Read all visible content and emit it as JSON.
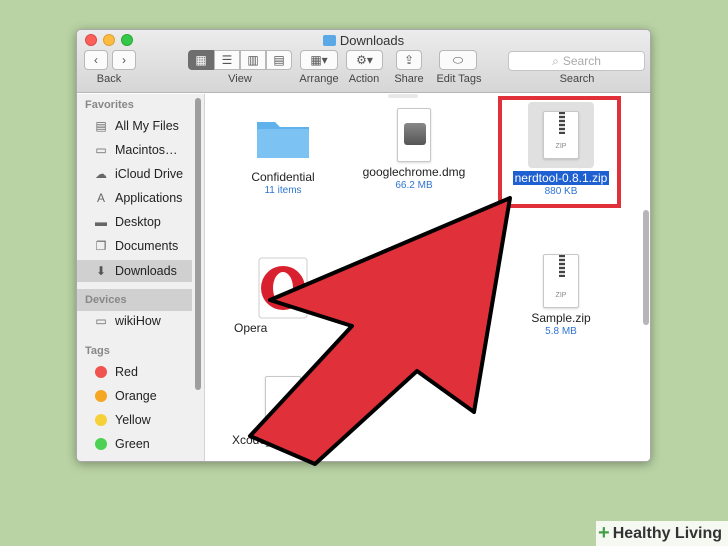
{
  "window": {
    "title": "Downloads",
    "toolbar": {
      "back_label": "Back",
      "view_label": "View",
      "arrange_label": "Arrange",
      "action_label": "Action",
      "share_label": "Share",
      "edit_tags_label": "Edit Tags",
      "search_label": "Search",
      "search_placeholder": "Search"
    }
  },
  "sidebar": {
    "favorites_header": "Favorites",
    "favorites": [
      {
        "label": "All My Files",
        "icon": "all-files-icon"
      },
      {
        "label": "Macintos…",
        "icon": "hard-drive-icon"
      },
      {
        "label": "iCloud Drive",
        "icon": "cloud-icon"
      },
      {
        "label": "Applications",
        "icon": "applications-icon"
      },
      {
        "label": "Desktop",
        "icon": "desktop-icon"
      },
      {
        "label": "Documents",
        "icon": "documents-icon"
      },
      {
        "label": "Downloads",
        "icon": "downloads-icon",
        "selected": true
      }
    ],
    "devices_header": "Devices",
    "devices": [
      {
        "label": "wikiHow",
        "icon": "disk-icon"
      }
    ],
    "tags_header": "Tags",
    "tags": [
      {
        "label": "Red",
        "color": "#f0534f"
      },
      {
        "label": "Orange",
        "color": "#f5a623"
      },
      {
        "label": "Yellow",
        "color": "#f6d038"
      },
      {
        "label": "Green",
        "color": "#4cd153"
      }
    ]
  },
  "files": [
    {
      "name": "Confidential",
      "meta": "11 items",
      "icon": "folder-icon"
    },
    {
      "name": "googlechrome.dmg",
      "meta": "66.2 MB",
      "icon": "disk-image-icon"
    },
    {
      "name": "nerdtool-0.8.1.zip",
      "meta": "880 KB",
      "icon": "zip-icon",
      "selected": true
    },
    {
      "name": "Opera",
      "meta": "",
      "icon": "opera-icon"
    },
    {
      "name": "Sample.zip",
      "meta": "5.8 MB",
      "icon": "zip-icon"
    },
    {
      "name": "Xcode_7",
      "meta": "",
      "icon": "document-icon"
    }
  ],
  "zip_label": "ZIP",
  "watermark": {
    "text": "Healthy Living",
    "symbol": "+"
  },
  "colors": {
    "highlight": "#e0303a",
    "arrow": "#e0303a",
    "selection": "#1e5fd1",
    "background": "#b9d3a4"
  }
}
